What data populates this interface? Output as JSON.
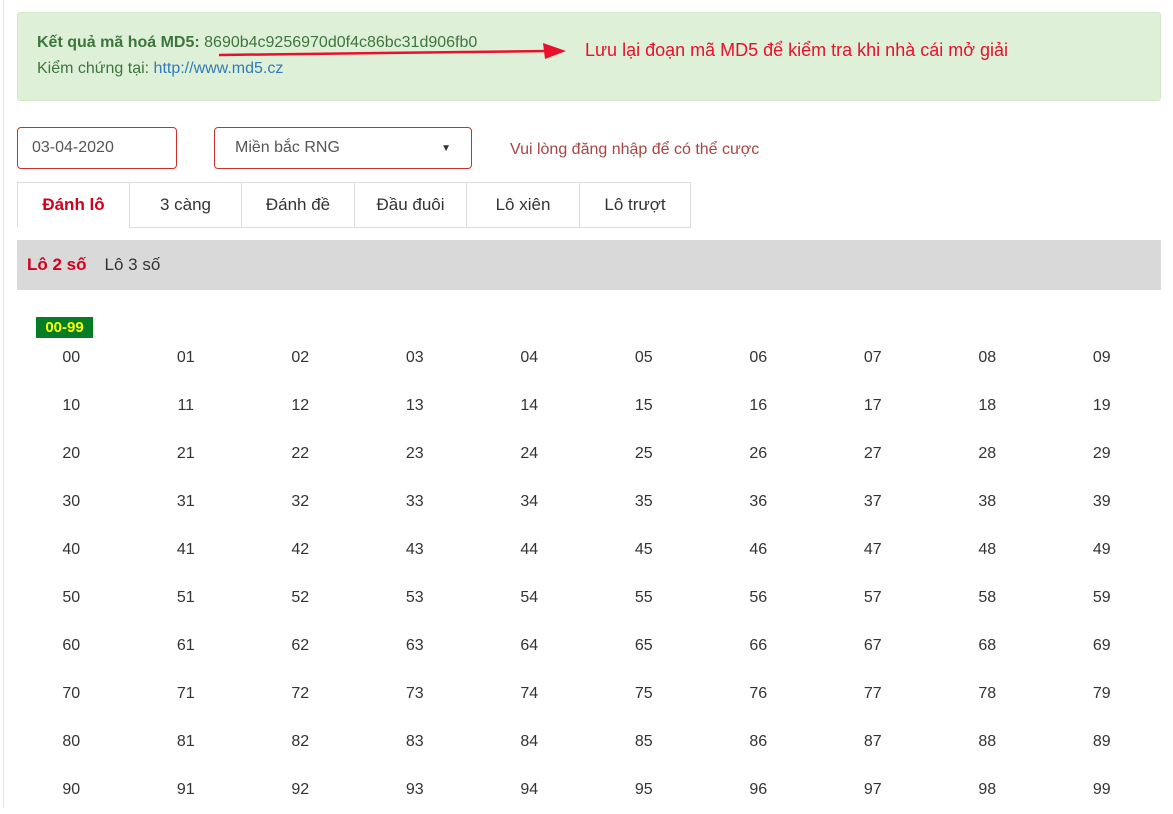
{
  "md5_box": {
    "label": "Kết quả mã hoá MD5:",
    "hash": "8690b4c9256970d0f4c86bc31d906fb0",
    "verify_label": "Kiểm chứng tại:",
    "verify_link": "http://www.md5.cz",
    "note": "Lưu lại đoạn mã MD5 để kiểm tra khi nhà cái mở giải"
  },
  "filters": {
    "date": "03-04-2020",
    "region": "Miền bắc RNG",
    "login_message": "Vui lòng đăng nhập để có thể cược"
  },
  "tabs": [
    {
      "label": "Đánh lô",
      "active": true
    },
    {
      "label": "3 càng"
    },
    {
      "label": "Đánh đề"
    },
    {
      "label": "Đầu đuôi"
    },
    {
      "label": "Lô xiên"
    },
    {
      "label": "Lô trượt"
    }
  ],
  "subtabs": [
    {
      "label": "Lô 2 số",
      "active": true
    },
    {
      "label": "Lô 3 số"
    }
  ],
  "range_badge": "00-99",
  "numbers": [
    [
      "00",
      "01",
      "02",
      "03",
      "04",
      "05",
      "06",
      "07",
      "08",
      "09"
    ],
    [
      "10",
      "11",
      "12",
      "13",
      "14",
      "15",
      "16",
      "17",
      "18",
      "19"
    ],
    [
      "20",
      "21",
      "22",
      "23",
      "24",
      "25",
      "26",
      "27",
      "28",
      "29"
    ],
    [
      "30",
      "31",
      "32",
      "33",
      "34",
      "35",
      "36",
      "37",
      "38",
      "39"
    ],
    [
      "40",
      "41",
      "42",
      "43",
      "44",
      "45",
      "46",
      "47",
      "48",
      "49"
    ],
    [
      "50",
      "51",
      "52",
      "53",
      "54",
      "55",
      "56",
      "57",
      "58",
      "59"
    ],
    [
      "60",
      "61",
      "62",
      "63",
      "64",
      "65",
      "66",
      "67",
      "68",
      "69"
    ],
    [
      "70",
      "71",
      "72",
      "73",
      "74",
      "75",
      "76",
      "77",
      "78",
      "79"
    ],
    [
      "80",
      "81",
      "82",
      "83",
      "84",
      "85",
      "86",
      "87",
      "88",
      "89"
    ],
    [
      "90",
      "91",
      "92",
      "93",
      "94",
      "95",
      "96",
      "97",
      "98",
      "99"
    ]
  ],
  "colors": {
    "accent_red": "#d0021b",
    "alert_bg": "#dff0d8",
    "badge_bg": "#047d24",
    "badge_text": "#ffff00"
  }
}
